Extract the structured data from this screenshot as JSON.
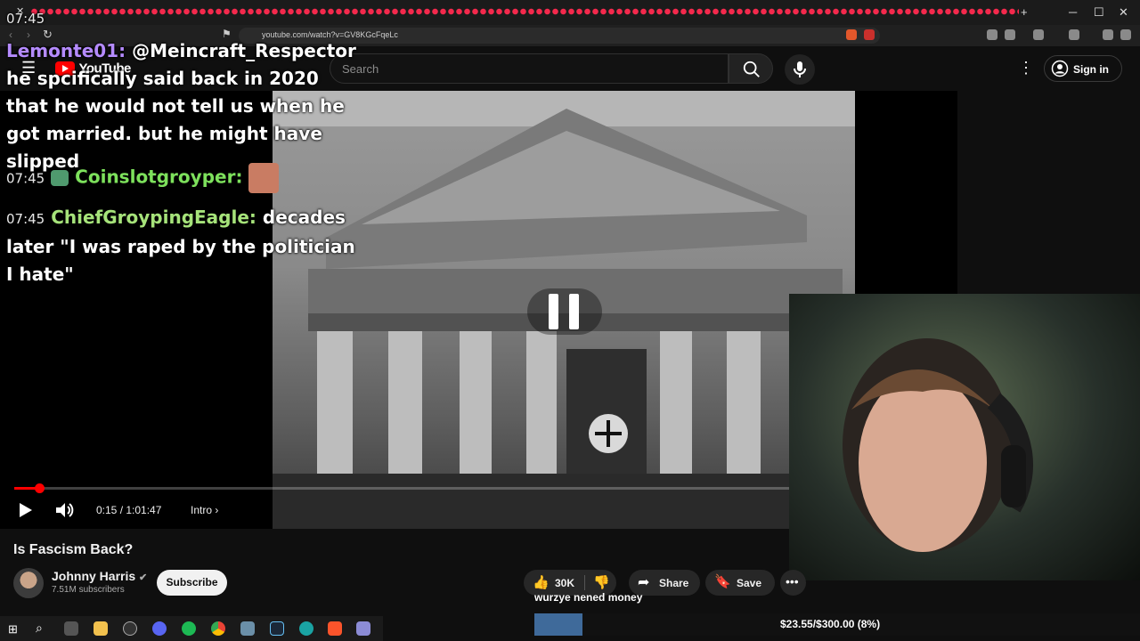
{
  "browser": {
    "url": "youtube.com/watch?v=GV8KGcFqeLc"
  },
  "youtube": {
    "logo": "YouTube",
    "search_placeholder": "Search",
    "sign_in": "Sign in"
  },
  "player": {
    "time": "0:15 / 1:01:47",
    "chapter": "Intro",
    "progress": 0.004
  },
  "chat": [
    {
      "time": "07:45",
      "user": "Lemonte01:",
      "user_color": "#b58bff",
      "text": "@Meincraft_Respector he spcifically said back in 2020 that he would not tell us when he got married. but he might have slipped"
    },
    {
      "time": "07:45",
      "user": "Coinslotgroyper:",
      "user_color": "#7de15c",
      "text": ""
    },
    {
      "time": "07:45",
      "user": "ChiefGroypingEagle:",
      "user_color": "#a6e37a",
      "text": "decades later \"I was raped by the politician I hate\""
    }
  ],
  "video": {
    "title": "Is Fascism Back?",
    "channel": "Johnny Harris",
    "subscribers": "7.51M subscribers",
    "subscribe": "Subscribe",
    "likes": "30K",
    "share": "Share",
    "save": "Save"
  },
  "stream_overlay": {
    "donation_text": "wurzye nened money",
    "goal_text": "$23.55/$300.00 (8%)",
    "goal_fraction": 0.08
  },
  "colors": {
    "youtube_red": "#ff0000",
    "tab_accent": "#ff2a4f"
  }
}
